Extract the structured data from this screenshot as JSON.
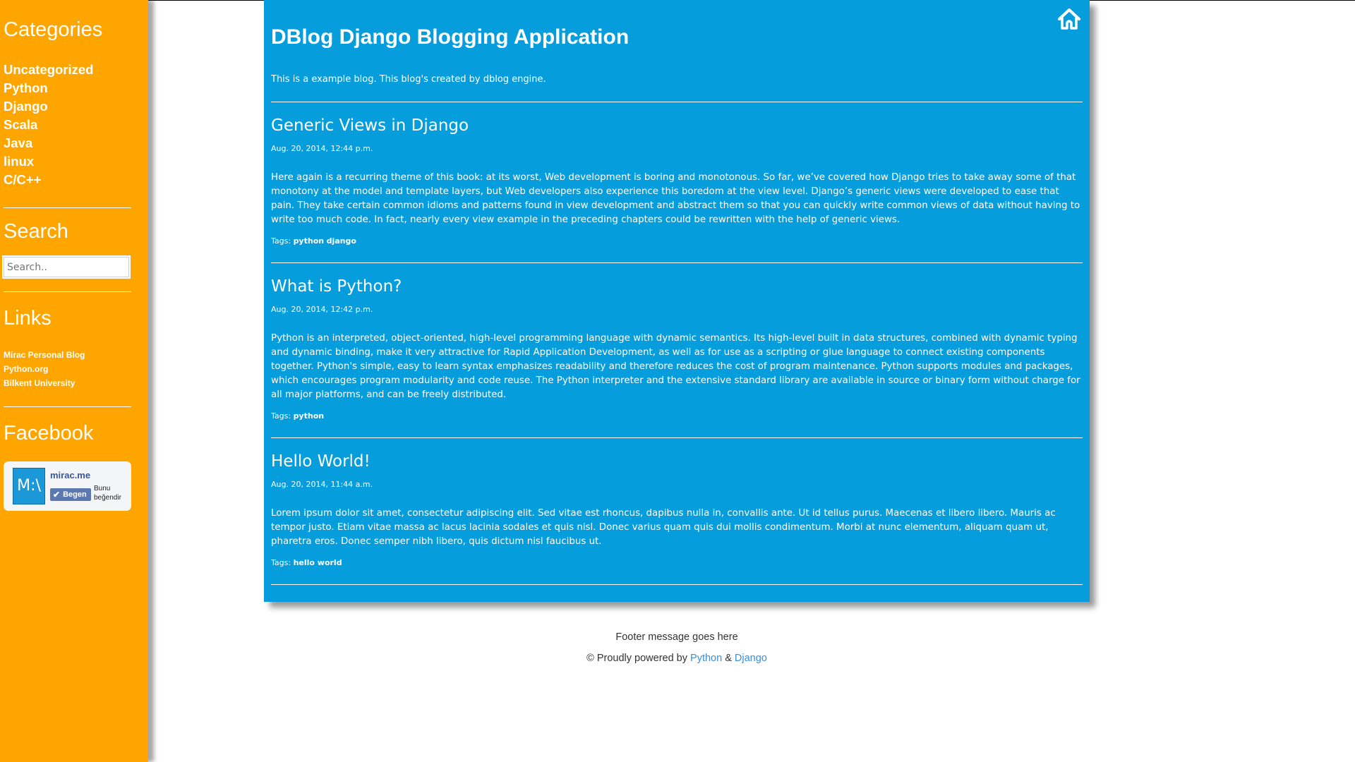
{
  "sidebar": {
    "categories_title": "Categories",
    "categories": [
      "Uncategorized",
      "Python",
      "Django",
      "Scala",
      "Java",
      "linux",
      "C/C++"
    ],
    "search_title": "Search",
    "search_placeholder": "Search..",
    "links_title": "Links",
    "links": [
      "Mirac Personal Blog",
      "Python.org",
      "Bilkent University"
    ],
    "facebook_title": "Facebook",
    "facebook": {
      "avatar_text": "M:\\",
      "page_name": "mirac.me",
      "like_label": "Begen",
      "like_text": "Bunu beğendir"
    }
  },
  "header": {
    "site_title": "DBlog Django Blogging Application",
    "tagline": "This is a example blog. This blog's created by dblog engine.",
    "home_icon": "home-icon"
  },
  "posts": [
    {
      "title": "Generic Views in Django",
      "date": "Aug. 20, 2014, 12:44 p.m.",
      "body": "Here again is a recurring theme of this book: at its worst, Web development is boring and monotonous. So far, we’ve covered how Django tries to take away some of that monotony at the model and template layers, but Web developers also experience this boredom at the view level. Django’s generic views were developed to ease that pain. They take certain common idioms and patterns found in view development and abstract them so that you can quickly write common views of data without having to write too much code. In fact, nearly every view example in the preceding chapters could be rewritten with the help of generic views.",
      "tags_label": "Tags:",
      "tags": [
        "python",
        "django"
      ]
    },
    {
      "title": "What is Python?",
      "date": "Aug. 20, 2014, 12:42 p.m.",
      "body": "Python is an interpreted, object-oriented, high-level programming language with dynamic semantics. Its high-level built in data structures, combined with dynamic typing and dynamic binding, make it very attractive for Rapid Application Development, as well as for use as a scripting or glue language to connect existing components together. Python's simple, easy to learn syntax emphasizes readability and therefore reduces the cost of program maintenance. Python supports modules and packages, which encourages program modularity and code reuse. The Python interpreter and the extensive standard library are available in source or binary form without charge for all major platforms, and can be freely distributed.",
      "tags_label": "Tags:",
      "tags": [
        "python"
      ]
    },
    {
      "title": "Hello World!",
      "date": "Aug. 20, 2014, 11:44 a.m.",
      "body": "Lorem ipsum dolor sit amet, consectetur adipiscing elit. Sed vitae est rhoncus, dapibus nulla in, convallis ante. Ut id tellus purus. Maecenas et libero libero. Mauris ac tempor justo. Etiam vitae massa ac lacus lacinia sodales et quis nisl. Donec varius quam quis dui mollis condimentum. Morbi at nunc elementum, aliquam quam ut, pharetra eros. Donec semper nibh libero, quis dictum nisl faucibus ut.",
      "tags_label": "Tags:",
      "tags": [
        "hello world"
      ]
    }
  ],
  "footer": {
    "message": "Footer message goes here",
    "powered_prefix": "© Proudly powered by",
    "python_link": "Python",
    "amp": "&",
    "django_link": "Django"
  },
  "colors": {
    "sidebar_bg": "#ffa500",
    "main_bg": "#069ddd",
    "link_blue": "#3b8ed6"
  }
}
